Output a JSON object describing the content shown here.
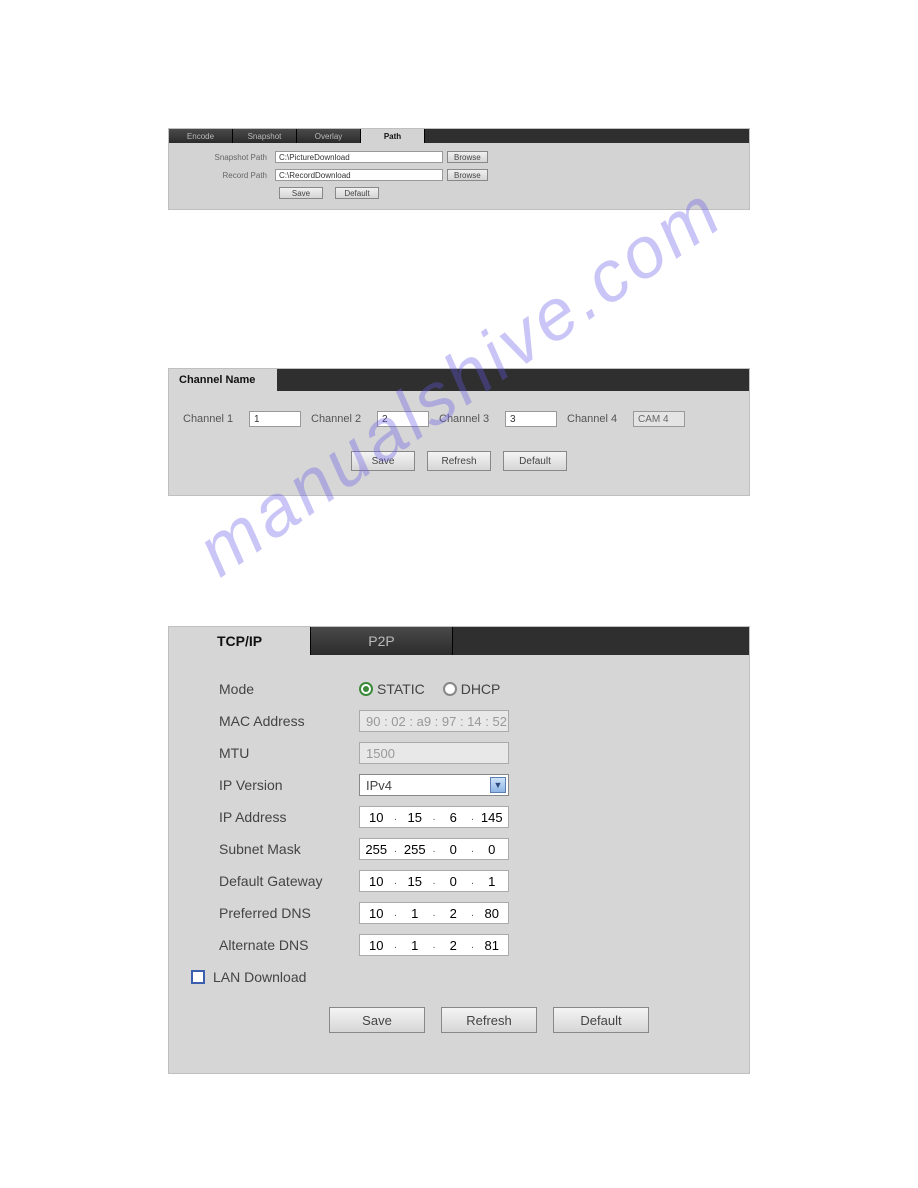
{
  "watermark": "manualshive.com",
  "panel1": {
    "tabs": [
      "Encode",
      "Snapshot",
      "Overlay",
      "Path"
    ],
    "activeTab": "Path",
    "rows": [
      {
        "label": "Snapshot Path",
        "value": "C:\\PictureDownload",
        "browse": "Browse"
      },
      {
        "label": "Record Path",
        "value": "C:\\RecordDownload",
        "browse": "Browse"
      }
    ],
    "buttons": {
      "save": "Save",
      "default": "Default"
    }
  },
  "panel2": {
    "tabLabel": "Channel Name",
    "channels": [
      {
        "label": "Channel 1",
        "value": "1"
      },
      {
        "label": "Channel 2",
        "value": "2"
      },
      {
        "label": "Channel 3",
        "value": "3"
      },
      {
        "label": "Channel 4",
        "value": "CAM 4"
      }
    ],
    "buttons": {
      "save": "Save",
      "refresh": "Refresh",
      "default": "Default"
    }
  },
  "panel3": {
    "tabs": [
      "TCP/IP",
      "P2P"
    ],
    "activeTab": "TCP/IP",
    "modeLabel": "Mode",
    "modes": {
      "static": "STATIC",
      "dhcp": "DHCP",
      "selected": "STATIC"
    },
    "macLabel": "MAC Address",
    "mac": "90 : 02 : a9 : 97 : 14 : 52",
    "mtuLabel": "MTU",
    "mtu": "1500",
    "ipVersionLabel": "IP Version",
    "ipVersion": "IPv4",
    "fields": {
      "ipAddress": {
        "label": "IP Address",
        "octets": [
          "10",
          "15",
          "6",
          "145"
        ]
      },
      "subnetMask": {
        "label": "Subnet Mask",
        "octets": [
          "255",
          "255",
          "0",
          "0"
        ]
      },
      "defaultGateway": {
        "label": "Default Gateway",
        "octets": [
          "10",
          "15",
          "0",
          "1"
        ]
      },
      "preferredDNS": {
        "label": "Preferred DNS",
        "octets": [
          "10",
          "1",
          "2",
          "80"
        ]
      },
      "alternateDNS": {
        "label": "Alternate DNS",
        "octets": [
          "10",
          "1",
          "2",
          "81"
        ]
      }
    },
    "lanDownloadLabel": "LAN Download",
    "lanDownloadChecked": false,
    "buttons": {
      "save": "Save",
      "refresh": "Refresh",
      "default": "Default"
    }
  }
}
